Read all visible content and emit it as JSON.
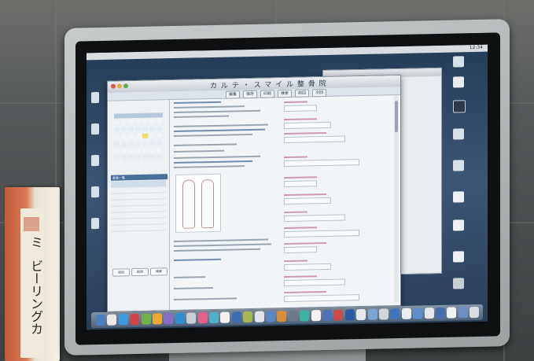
{
  "scene": {
    "book_title": "ビーリングカ",
    "book_mark": "ミ"
  },
  "window": {
    "title": "カ ル テ ・ ス マ イ ル 整 骨 院",
    "toolbar": [
      "編集",
      "保存",
      "印刷",
      "検索",
      "前回",
      "次回"
    ],
    "sidebar_list_header": "患者一覧",
    "sidebar_buttons": [
      "追加",
      "削除",
      "検索"
    ]
  },
  "menubar": {
    "apple": "",
    "clock": "12:34"
  },
  "colors": {
    "accent": "#4a6f9b",
    "field_label": "#b04a6a",
    "desktop": "#2f4764"
  }
}
